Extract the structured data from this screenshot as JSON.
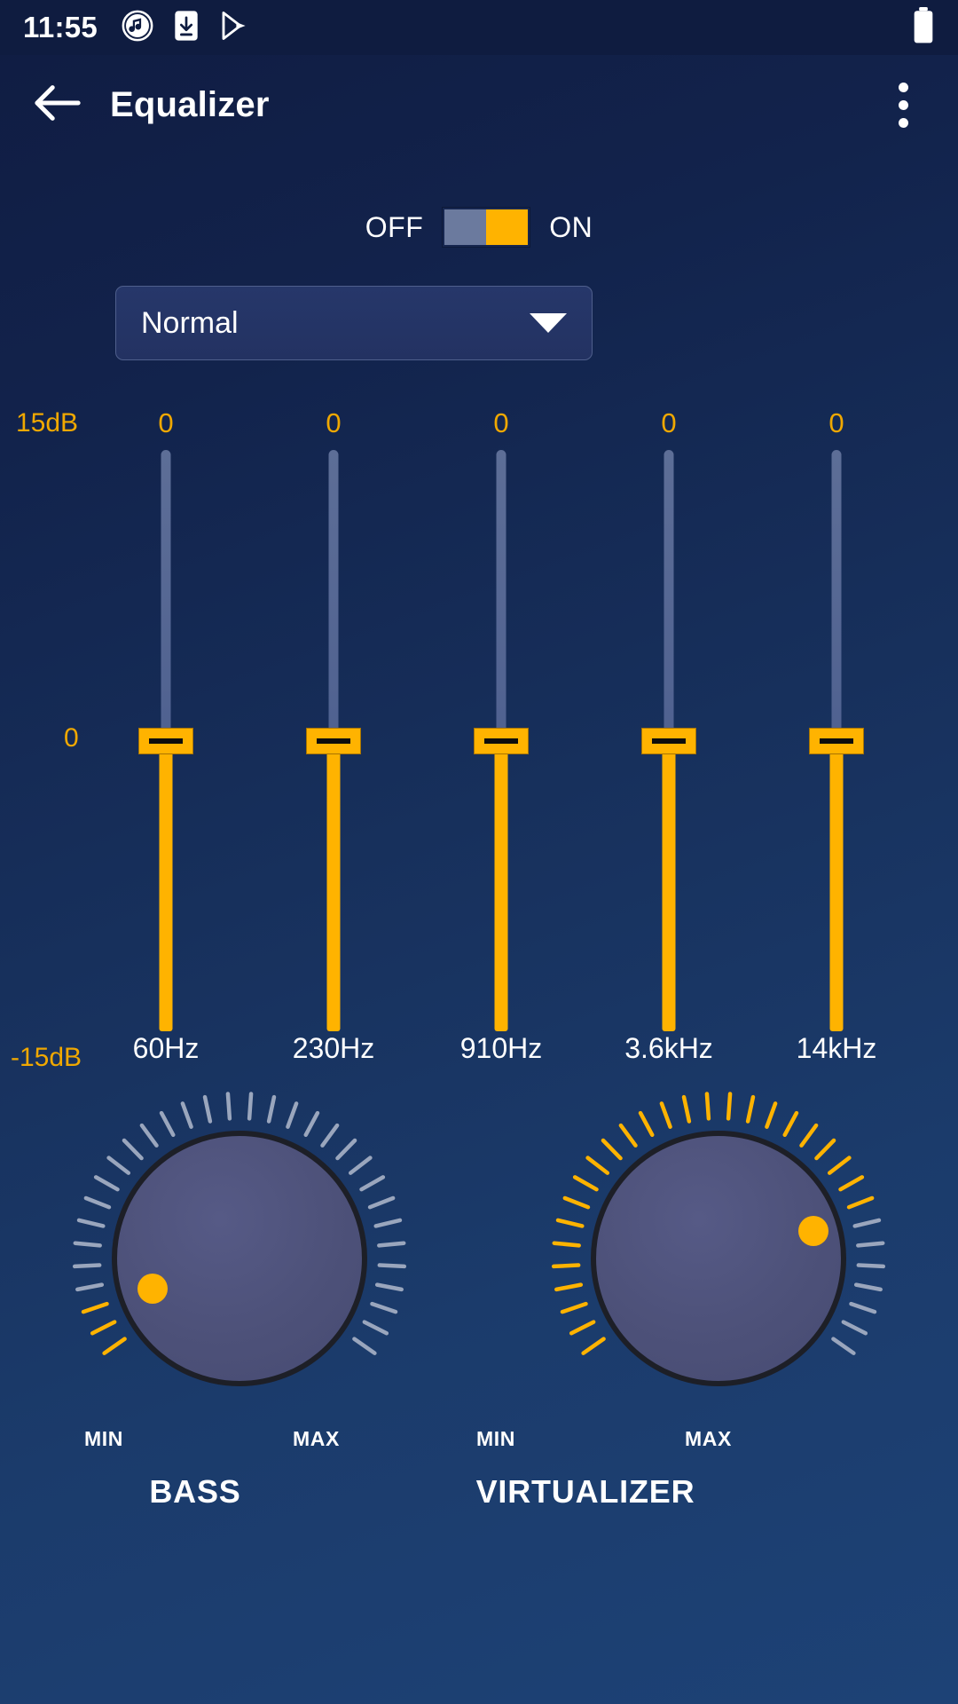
{
  "status_bar": {
    "clock": "11:55",
    "icons": [
      "music-note-icon",
      "download-icon",
      "play-store-icon"
    ],
    "battery": "battery-full-icon"
  },
  "app_bar": {
    "back": "back-arrow-icon",
    "title": "Equalizer",
    "overflow": "overflow-menu-icon"
  },
  "power": {
    "off_label": "OFF",
    "on_label": "ON",
    "state": "ON"
  },
  "preset": {
    "selected": "Normal",
    "caret": "chevron-down-icon"
  },
  "equalizer": {
    "scale_top": "15dB",
    "scale_mid": "0",
    "scale_bottom": "-15dB",
    "bands": [
      {
        "freq": "60Hz",
        "value": "0"
      },
      {
        "freq": "230Hz",
        "value": "0"
      },
      {
        "freq": "910Hz",
        "value": "0"
      },
      {
        "freq": "3.6kHz",
        "value": "0"
      },
      {
        "freq": "14kHz",
        "value": "0"
      }
    ]
  },
  "knobs": [
    {
      "name": "BASS",
      "min_label": "MIN",
      "max_label": "MAX",
      "level_pct": 8
    },
    {
      "name": "VIRTUALIZER",
      "min_label": "MIN",
      "max_label": "MAX",
      "level_pct": 78
    }
  ],
  "colors": {
    "accent": "#ffb300",
    "scale_text": "#f0a800",
    "background_top": "#101c42",
    "background_bottom": "#1d4276",
    "track_unfilled": "#5d6e97",
    "knob_face": "#4d5179"
  },
  "chart_data": {
    "type": "bar",
    "title": "Equalizer band gains",
    "categories": [
      "60Hz",
      "230Hz",
      "910Hz",
      "3.6kHz",
      "14kHz"
    ],
    "values": [
      0,
      0,
      0,
      0,
      0
    ],
    "ylabel": "dB",
    "ylim": [
      -15,
      15
    ],
    "ytick_labels": [
      "15dB",
      "0",
      "-15dB"
    ]
  }
}
